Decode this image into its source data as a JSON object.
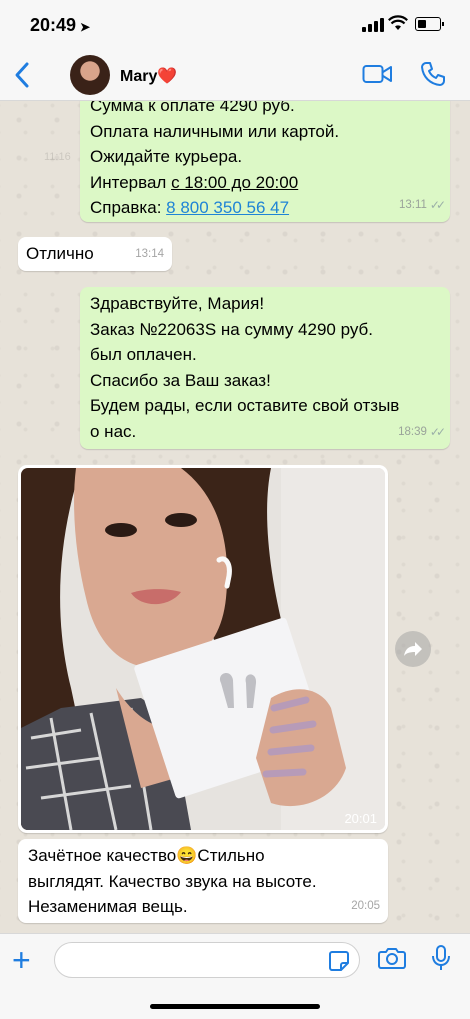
{
  "status_bar": {
    "time": "20:49"
  },
  "header": {
    "contact_name": "Mary",
    "contact_emoji": "❤️"
  },
  "messages": {
    "order_summary": {
      "lines": [
        "Сумма к оплате 4290 руб.",
        "Оплата наличными или картой.",
        "Ожидайте курьера."
      ],
      "interval_prefix": "Интервал ",
      "interval_value": "с 18:00 до 20:00",
      "help_prefix": "Справка: ",
      "help_phone": "8 800 350 56 47",
      "time": "13:11"
    },
    "reply_ok": {
      "text": "Отлично",
      "time": "13:14"
    },
    "payment_confirm": {
      "lines": [
        "Здравствуйте, Мария!",
        "Заказ №22063S на сумму 4290 руб.",
        "был оплачен.",
        "Спасибо за Ваш заказ!",
        "Будем рады, если оставите свой отзыв",
        "о нас."
      ],
      "time": "18:39"
    },
    "photo": {
      "time": "20:01"
    },
    "review": {
      "lines": [
        "Зачётное качество😄Стильно",
        "выглядят. Качество звука на высоте.",
        "Незаменимая вещь."
      ],
      "time": "20:05"
    }
  },
  "colors": {
    "accent": "#1f7de0",
    "outgoing_bubble": "#dcf8c6",
    "incoming_bubble": "#ffffff",
    "chat_bg": "#e7e2d9"
  }
}
